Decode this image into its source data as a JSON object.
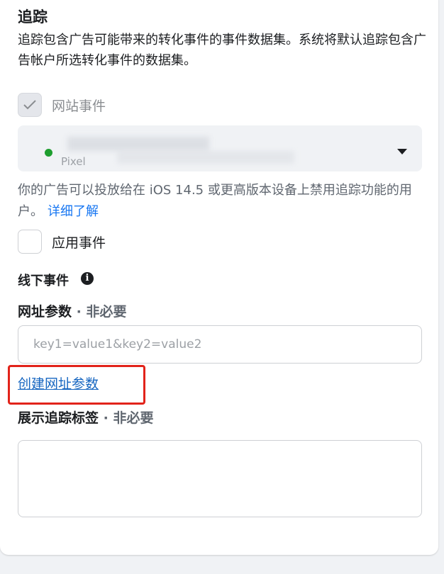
{
  "tracking": {
    "title": "追踪",
    "description": "追踪包含广告可能带来的转化事件的事件数据集。系统将默认追踪包含广告帐户所选转化事件的数据集。"
  },
  "website_events": {
    "label": "网站事件",
    "checked": true
  },
  "pixel_select": {
    "subtitle": "Pixel",
    "status_color": "#1e9e2f"
  },
  "ios_note": {
    "text": "你的广告可以投放给在 iOS 14.5 或更高版本设备上禁用追踪功能的用户。",
    "link": "详细了解"
  },
  "app_events": {
    "label": "应用事件",
    "checked": false
  },
  "offline_events": {
    "title": "线下事件",
    "info_icon": "info-icon"
  },
  "url_params": {
    "title": "网址参数",
    "optional": " · 非必要",
    "placeholder": "key1=value1&key2=value2",
    "create_link": "创建网址参数"
  },
  "display_tag": {
    "title": "展示追踪标签",
    "optional": " · 非必要"
  },
  "colors": {
    "link": "#1877f2",
    "highlight_box": "#e2231a"
  }
}
